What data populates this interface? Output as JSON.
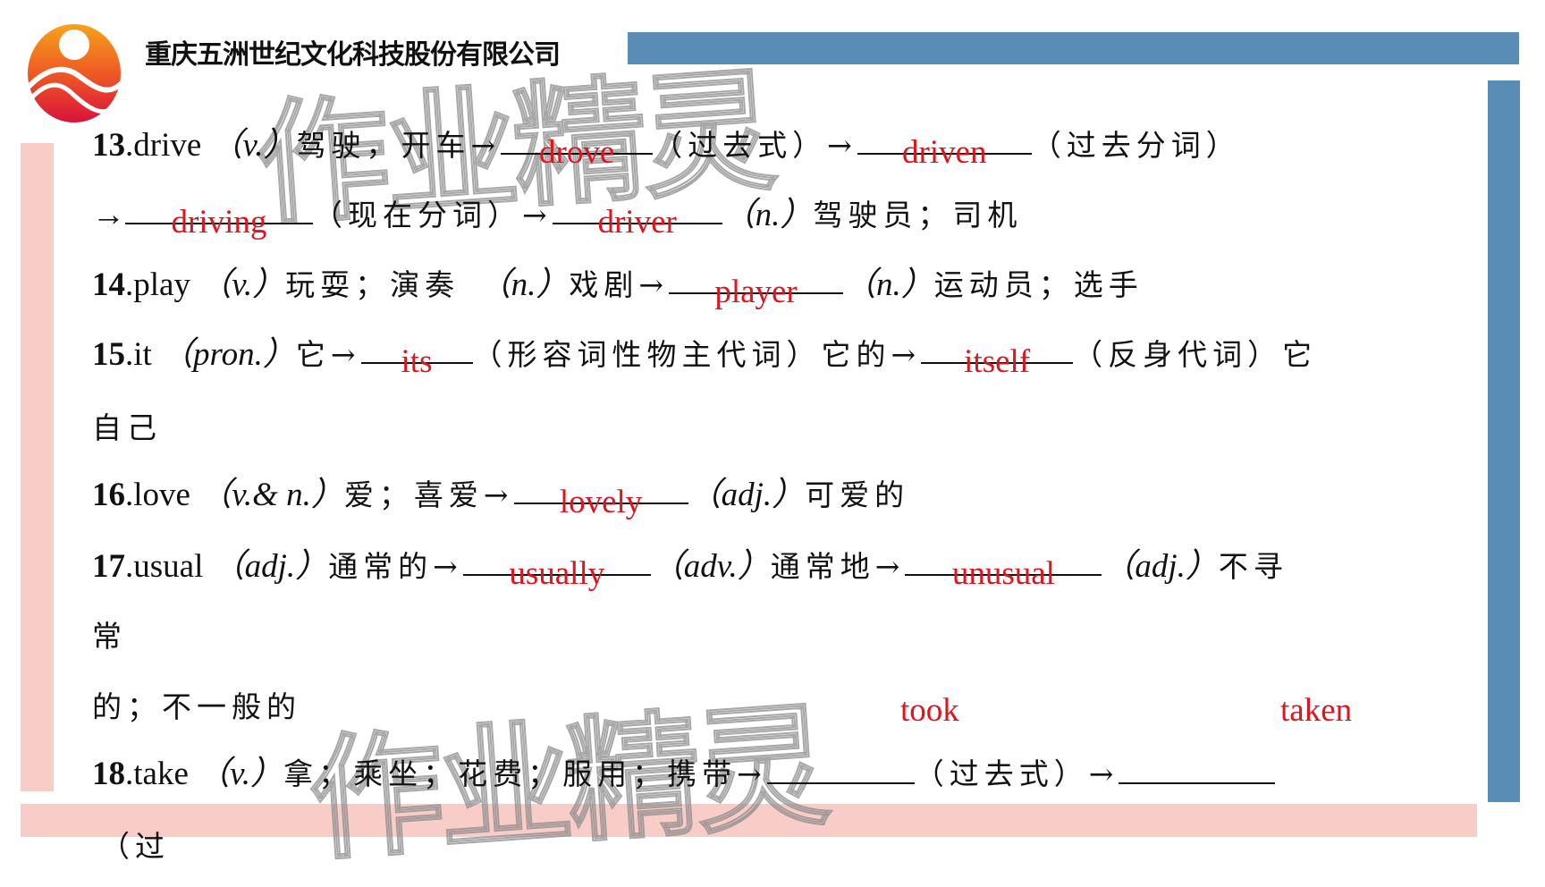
{
  "header": {
    "company_name": "重庆五洲世纪文化科技股份有限公司",
    "logo_icon": "wuzhou-logo-icon"
  },
  "watermark": {
    "text": "作业精灵"
  },
  "colors": {
    "accent_blue": "#5a8db5",
    "accent_pink": "#f8cdc7",
    "answer_red": "#e0141e"
  },
  "items": {
    "i13": {
      "num": "13",
      "word": ".drive ",
      "pos": "（v.）",
      "meaning": "驾驶，开车→",
      "a1": "drove",
      "t1": "（过去式）→",
      "a2": "driven",
      "t2": "（过去分词）",
      "line2_arrow": "→",
      "a3": "driving",
      "t3": "（现在分词）→",
      "a4": "driver",
      "t4_pos": "（n.）",
      "t4": "驾驶员；司机"
    },
    "i14": {
      "num": "14",
      "word": ".play ",
      "pos": "（v.）",
      "meaning": "玩耍；演奏　",
      "pos2": "（n.）",
      "meaning2": "戏剧→",
      "a1": "player",
      "t1_pos": "（n.）",
      "t1": "运动员；选手"
    },
    "i15": {
      "num": "15",
      "word": ".it ",
      "pos": "（pron.）",
      "meaning": "它→",
      "a1": "its",
      "t1": "（形容词性物主代词）它的→",
      "a2": "itself",
      "t2": "（反身代词）它",
      "cont": "自己"
    },
    "i16": {
      "num": "16",
      "word": ".love ",
      "pos": "（v.& n.）",
      "meaning": "爱；喜爱→",
      "a1": "lovely",
      "t1_pos": "（adj.）",
      "t1": "可爱的"
    },
    "i17": {
      "num": "17",
      "word": ".usual ",
      "pos": "（adj.）",
      "meaning": "通常的→",
      "a1": "usually",
      "t1_pos": "（adv.）",
      "t1": "通常地→",
      "a2": "unusual",
      "t2_pos": "（adj.）",
      "t2": "不寻",
      "cont1": "常",
      "cont2": "的；不一般的"
    },
    "i18": {
      "num": "18",
      "word": ".take ",
      "pos": "（v.）",
      "meaning": "拿；乘坐；花费；服用；携带→",
      "a1": "took",
      "t1": "（过去式）→",
      "a2": "taken",
      "cont": "（过"
    }
  }
}
